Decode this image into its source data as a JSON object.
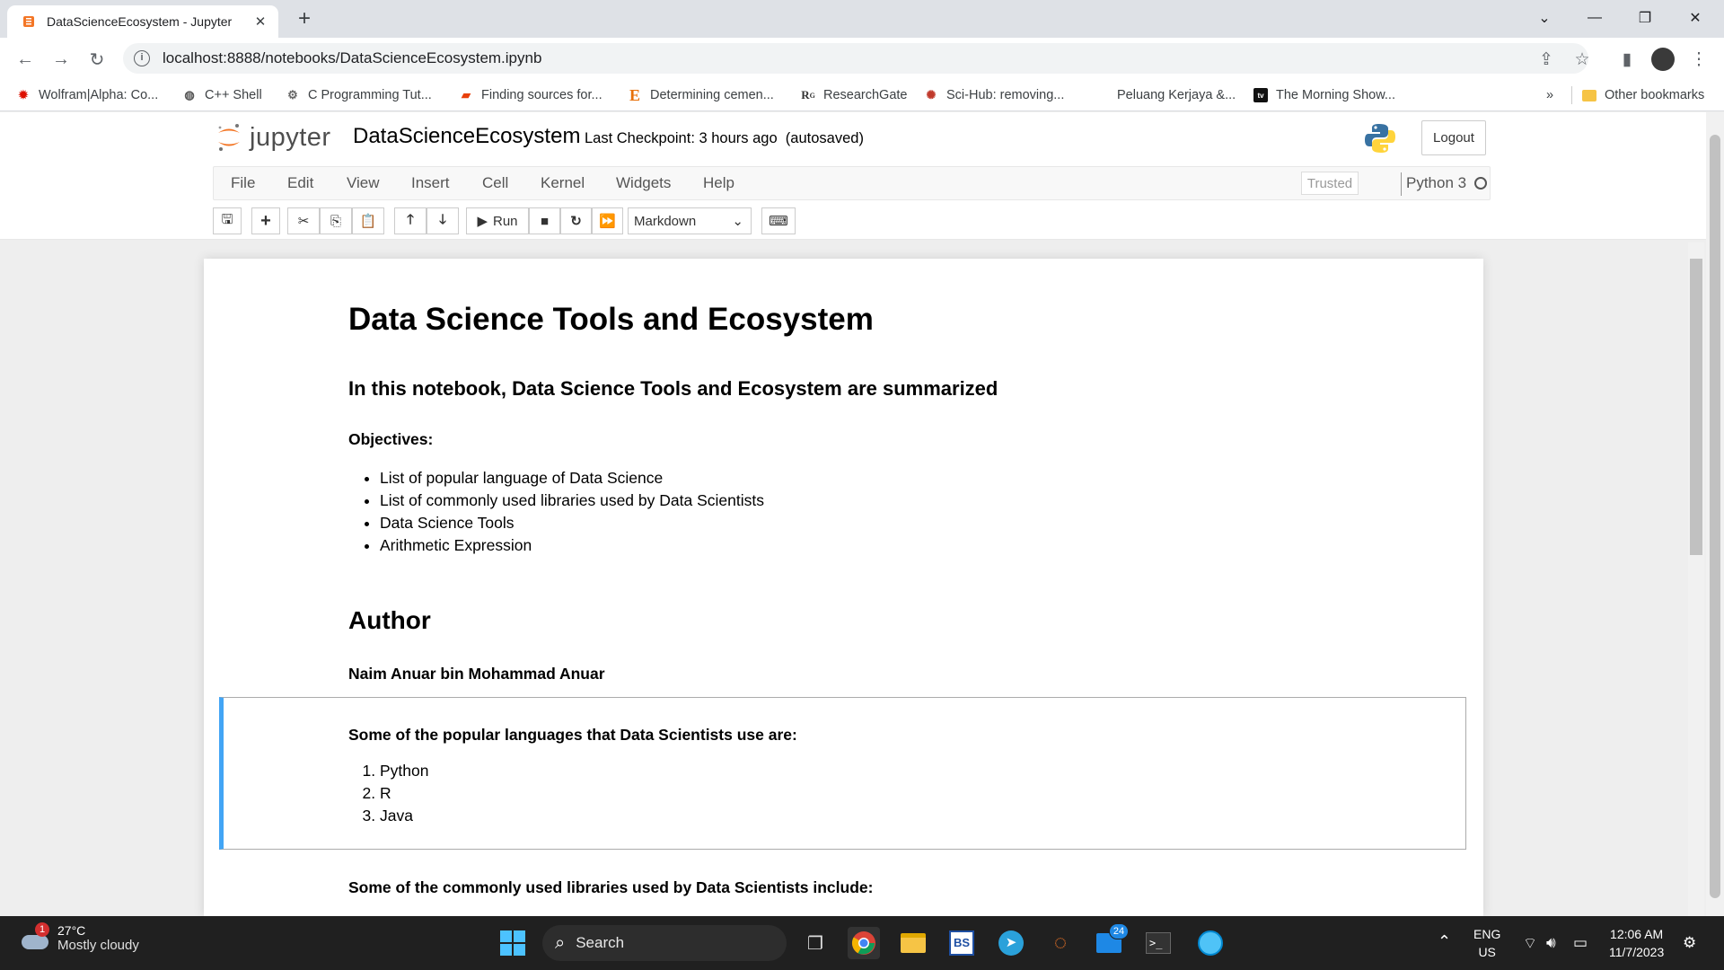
{
  "browser": {
    "tab_title": "DataScienceEcosystem - Jupyter",
    "new_tab": "+",
    "url": "localhost:8888/notebooks/DataScienceEcosystem.ipynb"
  },
  "bookmarks": [
    {
      "label": "Wolfram|Alpha: Co...",
      "icon": "wolfram-icon"
    },
    {
      "label": "C++ Shell",
      "icon": "cpp-shell-icon"
    },
    {
      "label": "C Programming Tut...",
      "icon": "c-programming-icon"
    },
    {
      "label": "Finding sources for...",
      "icon": "bookmark-icon"
    },
    {
      "label": "Determining cemen...",
      "icon": "e-icon"
    },
    {
      "label": "ResearchGate",
      "icon": "researchgate-icon"
    },
    {
      "label": "Sci-Hub: removing...",
      "icon": "scihub-icon"
    },
    {
      "label": "Peluang Kerjaya &...",
      "icon": ""
    },
    {
      "label": "The Morning Show...",
      "icon": "appletv-icon"
    }
  ],
  "bookmarks_more": "»",
  "other_bookmarks": "Other bookmarks",
  "jupyter": {
    "logo_text": "jupyter",
    "notebook_name": "DataScienceEcosystem",
    "checkpoint": "Last Checkpoint: 3 hours ago  (autosaved)",
    "logout": "Logout",
    "menus": [
      "File",
      "Edit",
      "View",
      "Insert",
      "Cell",
      "Kernel",
      "Widgets",
      "Help"
    ],
    "trusted": "Trusted",
    "kernel_name": "Python 3",
    "run_label": "Run",
    "cell_type": "Markdown"
  },
  "notebook": {
    "title": "Data Science Tools and Ecosystem",
    "intro": "In this notebook, Data Science Tools and Ecosystem are summarized",
    "objectives_label": "Objectives:",
    "objectives": [
      "List of popular language of Data Science",
      "List of commonly used libraries used by Data Scientists",
      "Data Science Tools",
      "Arithmetic Expression"
    ],
    "author_heading": "Author",
    "author_name": "Naim Anuar bin Mohammad Anuar",
    "languages_label": "Some of the popular languages that Data Scientists use are:",
    "languages": [
      "Python",
      "R",
      "Java"
    ],
    "libraries_label": "Some of the commonly used libraries used by Data Scientists include:"
  },
  "taskbar": {
    "weather_badge": "1",
    "temperature": "27°C",
    "weather": "Mostly cloudy",
    "search": "Search",
    "mail_badge": "24",
    "lang_top": "ENG",
    "lang_bottom": "US",
    "time": "12:06 AM",
    "date": "11/7/2023"
  },
  "colors": {
    "selected_cell": "#42a5f5",
    "jupyter_orange": "#f37626",
    "taskbar": "#202020"
  }
}
